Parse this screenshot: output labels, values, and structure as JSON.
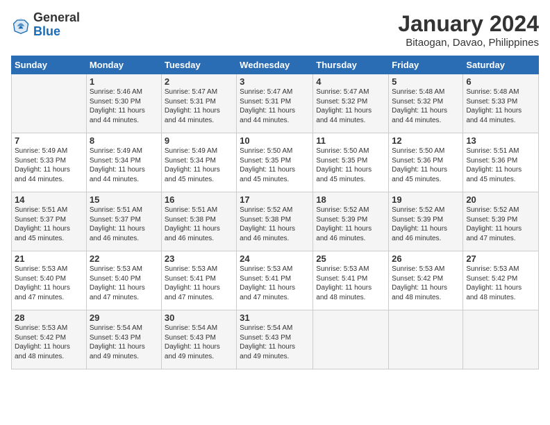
{
  "header": {
    "logo": {
      "line1": "General",
      "line2": "Blue"
    },
    "title": "January 2024",
    "location": "Bitaogan, Davao, Philippines"
  },
  "weekdays": [
    "Sunday",
    "Monday",
    "Tuesday",
    "Wednesday",
    "Thursday",
    "Friday",
    "Saturday"
  ],
  "weeks": [
    [
      {
        "day": "",
        "info": ""
      },
      {
        "day": "1",
        "info": "Sunrise: 5:46 AM\nSunset: 5:30 PM\nDaylight: 11 hours\nand 44 minutes."
      },
      {
        "day": "2",
        "info": "Sunrise: 5:47 AM\nSunset: 5:31 PM\nDaylight: 11 hours\nand 44 minutes."
      },
      {
        "day": "3",
        "info": "Sunrise: 5:47 AM\nSunset: 5:31 PM\nDaylight: 11 hours\nand 44 minutes."
      },
      {
        "day": "4",
        "info": "Sunrise: 5:47 AM\nSunset: 5:32 PM\nDaylight: 11 hours\nand 44 minutes."
      },
      {
        "day": "5",
        "info": "Sunrise: 5:48 AM\nSunset: 5:32 PM\nDaylight: 11 hours\nand 44 minutes."
      },
      {
        "day": "6",
        "info": "Sunrise: 5:48 AM\nSunset: 5:33 PM\nDaylight: 11 hours\nand 44 minutes."
      }
    ],
    [
      {
        "day": "7",
        "info": "Sunrise: 5:49 AM\nSunset: 5:33 PM\nDaylight: 11 hours\nand 44 minutes."
      },
      {
        "day": "8",
        "info": "Sunrise: 5:49 AM\nSunset: 5:34 PM\nDaylight: 11 hours\nand 44 minutes."
      },
      {
        "day": "9",
        "info": "Sunrise: 5:49 AM\nSunset: 5:34 PM\nDaylight: 11 hours\nand 45 minutes."
      },
      {
        "day": "10",
        "info": "Sunrise: 5:50 AM\nSunset: 5:35 PM\nDaylight: 11 hours\nand 45 minutes."
      },
      {
        "day": "11",
        "info": "Sunrise: 5:50 AM\nSunset: 5:35 PM\nDaylight: 11 hours\nand 45 minutes."
      },
      {
        "day": "12",
        "info": "Sunrise: 5:50 AM\nSunset: 5:36 PM\nDaylight: 11 hours\nand 45 minutes."
      },
      {
        "day": "13",
        "info": "Sunrise: 5:51 AM\nSunset: 5:36 PM\nDaylight: 11 hours\nand 45 minutes."
      }
    ],
    [
      {
        "day": "14",
        "info": "Sunrise: 5:51 AM\nSunset: 5:37 PM\nDaylight: 11 hours\nand 45 minutes."
      },
      {
        "day": "15",
        "info": "Sunrise: 5:51 AM\nSunset: 5:37 PM\nDaylight: 11 hours\nand 46 minutes."
      },
      {
        "day": "16",
        "info": "Sunrise: 5:51 AM\nSunset: 5:38 PM\nDaylight: 11 hours\nand 46 minutes."
      },
      {
        "day": "17",
        "info": "Sunrise: 5:52 AM\nSunset: 5:38 PM\nDaylight: 11 hours\nand 46 minutes."
      },
      {
        "day": "18",
        "info": "Sunrise: 5:52 AM\nSunset: 5:39 PM\nDaylight: 11 hours\nand 46 minutes."
      },
      {
        "day": "19",
        "info": "Sunrise: 5:52 AM\nSunset: 5:39 PM\nDaylight: 11 hours\nand 46 minutes."
      },
      {
        "day": "20",
        "info": "Sunrise: 5:52 AM\nSunset: 5:39 PM\nDaylight: 11 hours\nand 47 minutes."
      }
    ],
    [
      {
        "day": "21",
        "info": "Sunrise: 5:53 AM\nSunset: 5:40 PM\nDaylight: 11 hours\nand 47 minutes."
      },
      {
        "day": "22",
        "info": "Sunrise: 5:53 AM\nSunset: 5:40 PM\nDaylight: 11 hours\nand 47 minutes."
      },
      {
        "day": "23",
        "info": "Sunrise: 5:53 AM\nSunset: 5:41 PM\nDaylight: 11 hours\nand 47 minutes."
      },
      {
        "day": "24",
        "info": "Sunrise: 5:53 AM\nSunset: 5:41 PM\nDaylight: 11 hours\nand 47 minutes."
      },
      {
        "day": "25",
        "info": "Sunrise: 5:53 AM\nSunset: 5:41 PM\nDaylight: 11 hours\nand 48 minutes."
      },
      {
        "day": "26",
        "info": "Sunrise: 5:53 AM\nSunset: 5:42 PM\nDaylight: 11 hours\nand 48 minutes."
      },
      {
        "day": "27",
        "info": "Sunrise: 5:53 AM\nSunset: 5:42 PM\nDaylight: 11 hours\nand 48 minutes."
      }
    ],
    [
      {
        "day": "28",
        "info": "Sunrise: 5:53 AM\nSunset: 5:42 PM\nDaylight: 11 hours\nand 48 minutes."
      },
      {
        "day": "29",
        "info": "Sunrise: 5:54 AM\nSunset: 5:43 PM\nDaylight: 11 hours\nand 49 minutes."
      },
      {
        "day": "30",
        "info": "Sunrise: 5:54 AM\nSunset: 5:43 PM\nDaylight: 11 hours\nand 49 minutes."
      },
      {
        "day": "31",
        "info": "Sunrise: 5:54 AM\nSunset: 5:43 PM\nDaylight: 11 hours\nand 49 minutes."
      },
      {
        "day": "",
        "info": ""
      },
      {
        "day": "",
        "info": ""
      },
      {
        "day": "",
        "info": ""
      }
    ]
  ]
}
